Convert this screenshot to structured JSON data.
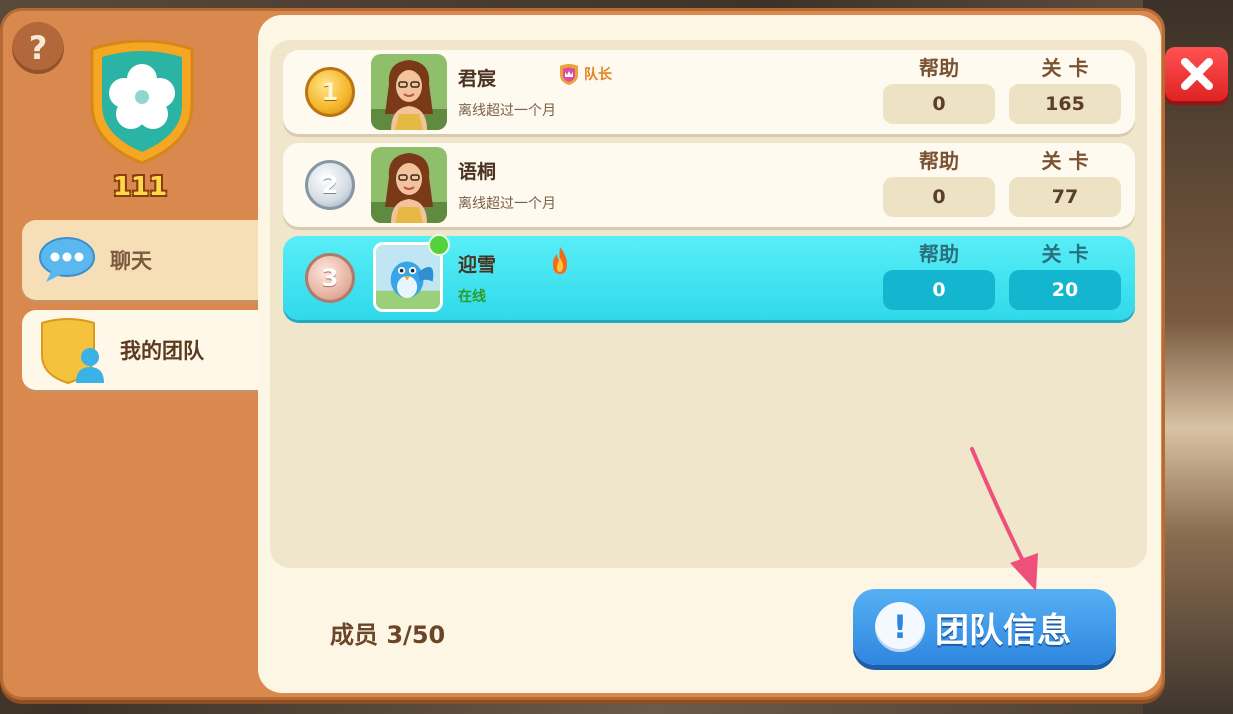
{
  "team": {
    "level": "111"
  },
  "sidebar": {
    "tabs": [
      {
        "label": "聊天",
        "icon": "chat-bubble-icon"
      },
      {
        "label": "我的团队",
        "icon": "team-shield-icon"
      }
    ]
  },
  "members": [
    {
      "rank": "1",
      "name": "君宸",
      "badge": "队长",
      "status": "离线超过一个月",
      "help": "0",
      "level": "165",
      "online": false
    },
    {
      "rank": "2",
      "name": "语桐",
      "badge": "",
      "status": "离线超过一个月",
      "help": "0",
      "level": "77",
      "online": false
    },
    {
      "rank": "3",
      "name": "迎雪",
      "badge": "",
      "status": "在线",
      "help": "0",
      "level": "20",
      "online": true
    }
  ],
  "columns": {
    "help": "帮助",
    "level": "关 卡"
  },
  "footer": {
    "members_label": "成员",
    "members_count": "3/50",
    "team_info_button": "团队信息"
  },
  "colors": {
    "panel_orange": "#d9894e",
    "panel_cream": "#fdf6e4",
    "online_row": "#2fd9ea",
    "button_blue": "#2f86df",
    "close_red": "#e02323",
    "arrow_pink": "#ef4f7b"
  }
}
